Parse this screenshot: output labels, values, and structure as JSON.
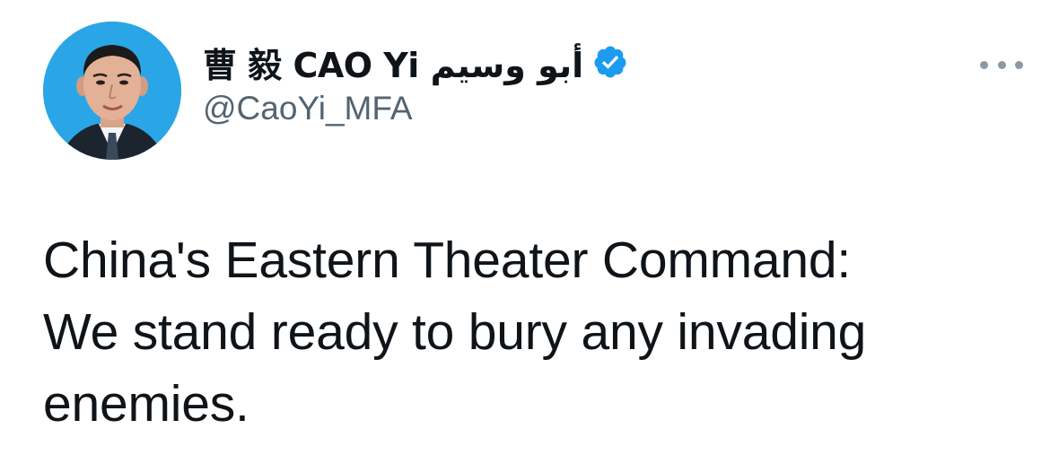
{
  "tweet": {
    "author": {
      "display_name": "曹 毅 CAO Yi أبو وسيم",
      "handle": "@CaoYi_MFA",
      "verified": true,
      "avatar_icon": "profile-photo"
    },
    "text": "China's Eastern Theater Command:\nWe stand ready to bury any invading\nenemies.",
    "more_icon": "more-horizontal-icon"
  },
  "colors": {
    "verified_badge": "#1d9bf0",
    "handle": "#536471",
    "text": "#0f1419",
    "avatar_background": "#2aa6e6"
  }
}
